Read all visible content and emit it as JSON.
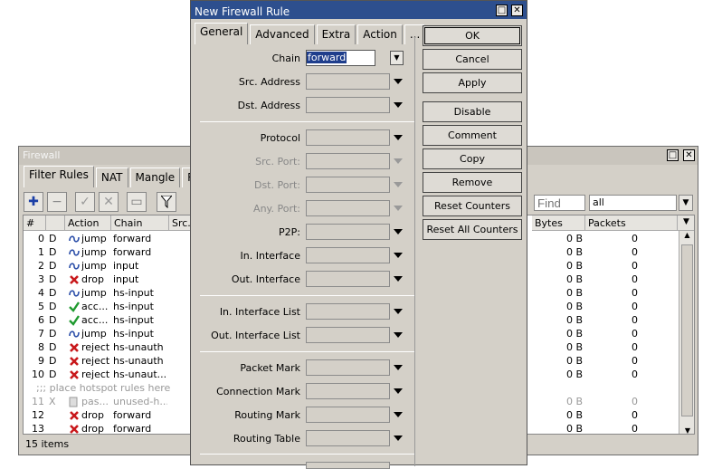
{
  "firewall": {
    "title": "Firewall",
    "tabs": [
      "Filter Rules",
      "NAT",
      "Mangle",
      "Raw"
    ],
    "find_placeholder": "Find",
    "filter_value": "all",
    "columns": [
      "#",
      "Action",
      "Chain",
      "Src.",
      "Bytes",
      "Packets"
    ],
    "rows": [
      {
        "num": "0",
        "flag": "D",
        "action": "jump",
        "chain": "forward",
        "bytes": "0 B",
        "packets": "0"
      },
      {
        "num": "1",
        "flag": "D",
        "action": "jump",
        "chain": "forward",
        "bytes": "0 B",
        "packets": "0"
      },
      {
        "num": "2",
        "flag": "D",
        "action": "jump",
        "chain": "input",
        "bytes": "0 B",
        "packets": "0"
      },
      {
        "num": "3",
        "flag": "D",
        "action": "drop",
        "chain": "input",
        "bytes": "0 B",
        "packets": "0"
      },
      {
        "num": "4",
        "flag": "D",
        "action": "jump",
        "chain": "hs-input",
        "bytes": "0 B",
        "packets": "0"
      },
      {
        "num": "5",
        "flag": "D",
        "action": "acc...",
        "chain": "hs-input",
        "bytes": "0 B",
        "packets": "0"
      },
      {
        "num": "6",
        "flag": "D",
        "action": "acc...",
        "chain": "hs-input",
        "bytes": "0 B",
        "packets": "0"
      },
      {
        "num": "7",
        "flag": "D",
        "action": "jump",
        "chain": "hs-input",
        "bytes": "0 B",
        "packets": "0"
      },
      {
        "num": "8",
        "flag": "D",
        "action": "reject",
        "chain": "hs-unauth",
        "bytes": "0 B",
        "packets": "0"
      },
      {
        "num": "9",
        "flag": "D",
        "action": "reject",
        "chain": "hs-unauth",
        "bytes": "0 B",
        "packets": "0"
      },
      {
        "num": "10",
        "flag": "D",
        "action": "reject",
        "chain": "hs-unaut...",
        "bytes": "0 B",
        "packets": "0"
      }
    ],
    "comment_row": ";;; place hotspot rules here",
    "rows2": [
      {
        "num": "11",
        "flag": "X",
        "action": "pas...",
        "chain": "unused-h...",
        "bytes": "0 B",
        "packets": "0"
      },
      {
        "num": "12",
        "flag": "",
        "action": "drop",
        "chain": "forward",
        "bytes": "0 B",
        "packets": "0"
      },
      {
        "num": "13",
        "flag": "",
        "action": "drop",
        "chain": "forward",
        "bytes": "0 B",
        "packets": "0"
      }
    ],
    "status": "15 items"
  },
  "dialog": {
    "title": "New Firewall Rule",
    "tabs": [
      "General",
      "Advanced",
      "Extra",
      "Action",
      "..."
    ],
    "chain_label": "Chain",
    "chain_value": "forward",
    "fields1": [
      "Src. Address",
      "Dst. Address"
    ],
    "fields2": [
      "Protocol",
      "Src. Port:",
      "Dst. Port:",
      "Any. Port:",
      "P2P:",
      "In. Interface",
      "Out. Interface"
    ],
    "fields3": [
      "In. Interface List",
      "Out. Interface List"
    ],
    "fields4": [
      "Packet Mark",
      "Connection Mark",
      "Routing Mark",
      "Routing Table"
    ],
    "buttons": [
      "OK",
      "Cancel",
      "Apply",
      "Disable",
      "Comment",
      "Copy",
      "Remove",
      "Reset Counters",
      "Reset All Counters"
    ]
  }
}
